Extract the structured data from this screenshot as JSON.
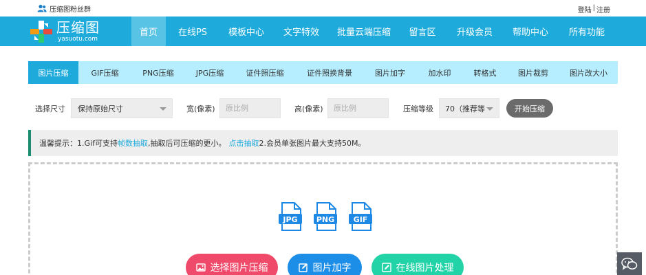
{
  "topbar": {
    "fan_group": "压缩图粉丝群",
    "login": "登陆",
    "separator": "|",
    "register": "注册"
  },
  "brand": {
    "name": "压缩图",
    "domain": "yasuotu.com",
    "colors": {
      "header": "#1eabdc",
      "active_nav": "#59c3e6",
      "tabs_bg": "#b6eeff"
    }
  },
  "nav": [
    {
      "label": "首页",
      "active": true
    },
    {
      "label": "在线PS"
    },
    {
      "label": "模板中心"
    },
    {
      "label": "文字特效"
    },
    {
      "label": "批量云端压缩"
    },
    {
      "label": "留言区"
    },
    {
      "label": "升级会员"
    },
    {
      "label": "帮助中心"
    },
    {
      "label": "所有功能"
    }
  ],
  "tabs": [
    {
      "label": "图片压缩",
      "active": true
    },
    {
      "label": "GIF压缩"
    },
    {
      "label": "PNG压缩"
    },
    {
      "label": "JPG压缩"
    },
    {
      "label": "证件照压缩"
    },
    {
      "label": "证件照换背景"
    },
    {
      "label": "图片加字"
    },
    {
      "label": "加水印"
    },
    {
      "label": "转格式"
    },
    {
      "label": "图片裁剪"
    },
    {
      "label": "图片改大小"
    }
  ],
  "settings": {
    "size_label": "选择尺寸",
    "size_value": "保持原始尺寸",
    "width_label": "宽(像素)",
    "width_placeholder": "原比例",
    "height_label": "高(像素)",
    "height_placeholder": "原比例",
    "level_label": "压缩等级",
    "level_value": "70（推荐等",
    "start_button": "开始压缩"
  },
  "notice": {
    "prefix": "温馨提示：1.Gif可支持",
    "link1": "帧数抽取",
    "middle": ",抽取后可压缩的更小。",
    "link2": "点击抽取",
    "suffix": " 2.会员单张图片最大支持50M。",
    "accent": "#1a8d73"
  },
  "upload": {
    "formats": [
      "JPG",
      "PNG",
      "GIF"
    ],
    "select_button": "选择图片压缩",
    "text_button": "图片加字",
    "online_button": "在线图片处理",
    "colors": {
      "select": "#ef4a6a",
      "text": "#1c8ee8",
      "online": "#21d3a6"
    }
  },
  "icons": {
    "fan_group": "users-icon",
    "select": "image-upload-icon",
    "text": "edit-icon",
    "online": "image-edit-icon",
    "chat": "wechat-icon"
  }
}
